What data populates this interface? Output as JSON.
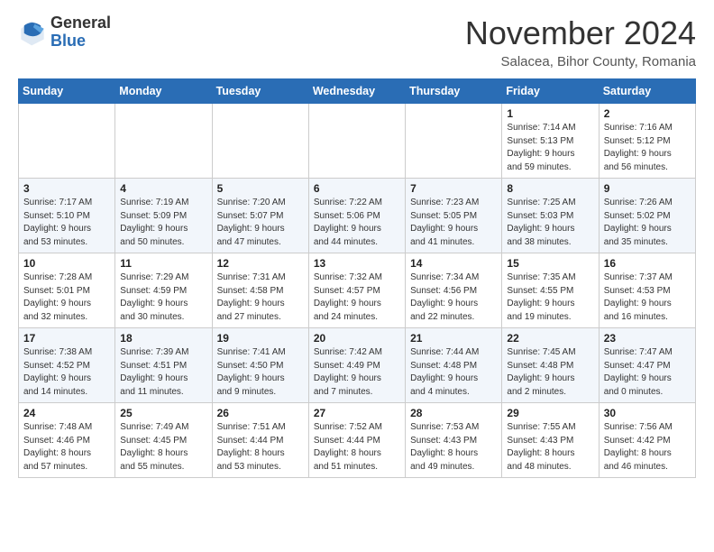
{
  "header": {
    "logo_general": "General",
    "logo_blue": "Blue",
    "month_title": "November 2024",
    "location": "Salacea, Bihor County, Romania"
  },
  "weekdays": [
    "Sunday",
    "Monday",
    "Tuesday",
    "Wednesday",
    "Thursday",
    "Friday",
    "Saturday"
  ],
  "weeks": [
    [
      {
        "day": "",
        "info": ""
      },
      {
        "day": "",
        "info": ""
      },
      {
        "day": "",
        "info": ""
      },
      {
        "day": "",
        "info": ""
      },
      {
        "day": "",
        "info": ""
      },
      {
        "day": "1",
        "info": "Sunrise: 7:14 AM\nSunset: 5:13 PM\nDaylight: 9 hours\nand 59 minutes."
      },
      {
        "day": "2",
        "info": "Sunrise: 7:16 AM\nSunset: 5:12 PM\nDaylight: 9 hours\nand 56 minutes."
      }
    ],
    [
      {
        "day": "3",
        "info": "Sunrise: 7:17 AM\nSunset: 5:10 PM\nDaylight: 9 hours\nand 53 minutes."
      },
      {
        "day": "4",
        "info": "Sunrise: 7:19 AM\nSunset: 5:09 PM\nDaylight: 9 hours\nand 50 minutes."
      },
      {
        "day": "5",
        "info": "Sunrise: 7:20 AM\nSunset: 5:07 PM\nDaylight: 9 hours\nand 47 minutes."
      },
      {
        "day": "6",
        "info": "Sunrise: 7:22 AM\nSunset: 5:06 PM\nDaylight: 9 hours\nand 44 minutes."
      },
      {
        "day": "7",
        "info": "Sunrise: 7:23 AM\nSunset: 5:05 PM\nDaylight: 9 hours\nand 41 minutes."
      },
      {
        "day": "8",
        "info": "Sunrise: 7:25 AM\nSunset: 5:03 PM\nDaylight: 9 hours\nand 38 minutes."
      },
      {
        "day": "9",
        "info": "Sunrise: 7:26 AM\nSunset: 5:02 PM\nDaylight: 9 hours\nand 35 minutes."
      }
    ],
    [
      {
        "day": "10",
        "info": "Sunrise: 7:28 AM\nSunset: 5:01 PM\nDaylight: 9 hours\nand 32 minutes."
      },
      {
        "day": "11",
        "info": "Sunrise: 7:29 AM\nSunset: 4:59 PM\nDaylight: 9 hours\nand 30 minutes."
      },
      {
        "day": "12",
        "info": "Sunrise: 7:31 AM\nSunset: 4:58 PM\nDaylight: 9 hours\nand 27 minutes."
      },
      {
        "day": "13",
        "info": "Sunrise: 7:32 AM\nSunset: 4:57 PM\nDaylight: 9 hours\nand 24 minutes."
      },
      {
        "day": "14",
        "info": "Sunrise: 7:34 AM\nSunset: 4:56 PM\nDaylight: 9 hours\nand 22 minutes."
      },
      {
        "day": "15",
        "info": "Sunrise: 7:35 AM\nSunset: 4:55 PM\nDaylight: 9 hours\nand 19 minutes."
      },
      {
        "day": "16",
        "info": "Sunrise: 7:37 AM\nSunset: 4:53 PM\nDaylight: 9 hours\nand 16 minutes."
      }
    ],
    [
      {
        "day": "17",
        "info": "Sunrise: 7:38 AM\nSunset: 4:52 PM\nDaylight: 9 hours\nand 14 minutes."
      },
      {
        "day": "18",
        "info": "Sunrise: 7:39 AM\nSunset: 4:51 PM\nDaylight: 9 hours\nand 11 minutes."
      },
      {
        "day": "19",
        "info": "Sunrise: 7:41 AM\nSunset: 4:50 PM\nDaylight: 9 hours\nand 9 minutes."
      },
      {
        "day": "20",
        "info": "Sunrise: 7:42 AM\nSunset: 4:49 PM\nDaylight: 9 hours\nand 7 minutes."
      },
      {
        "day": "21",
        "info": "Sunrise: 7:44 AM\nSunset: 4:48 PM\nDaylight: 9 hours\nand 4 minutes."
      },
      {
        "day": "22",
        "info": "Sunrise: 7:45 AM\nSunset: 4:48 PM\nDaylight: 9 hours\nand 2 minutes."
      },
      {
        "day": "23",
        "info": "Sunrise: 7:47 AM\nSunset: 4:47 PM\nDaylight: 9 hours\nand 0 minutes."
      }
    ],
    [
      {
        "day": "24",
        "info": "Sunrise: 7:48 AM\nSunset: 4:46 PM\nDaylight: 8 hours\nand 57 minutes."
      },
      {
        "day": "25",
        "info": "Sunrise: 7:49 AM\nSunset: 4:45 PM\nDaylight: 8 hours\nand 55 minutes."
      },
      {
        "day": "26",
        "info": "Sunrise: 7:51 AM\nSunset: 4:44 PM\nDaylight: 8 hours\nand 53 minutes."
      },
      {
        "day": "27",
        "info": "Sunrise: 7:52 AM\nSunset: 4:44 PM\nDaylight: 8 hours\nand 51 minutes."
      },
      {
        "day": "28",
        "info": "Sunrise: 7:53 AM\nSunset: 4:43 PM\nDaylight: 8 hours\nand 49 minutes."
      },
      {
        "day": "29",
        "info": "Sunrise: 7:55 AM\nSunset: 4:43 PM\nDaylight: 8 hours\nand 48 minutes."
      },
      {
        "day": "30",
        "info": "Sunrise: 7:56 AM\nSunset: 4:42 PM\nDaylight: 8 hours\nand 46 minutes."
      }
    ]
  ]
}
